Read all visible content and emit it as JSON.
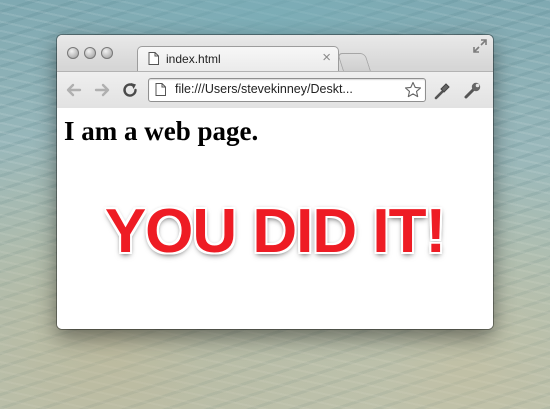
{
  "window": {
    "controls": [
      "close-button",
      "minimize-button",
      "zoom-button"
    ]
  },
  "tab": {
    "title": "index.html",
    "close_label": "×"
  },
  "toolbar": {
    "back_icon": "back-arrow-icon",
    "forward_icon": "forward-arrow-icon",
    "reload_icon": "reload-icon",
    "url": "file:///Users/stevekinney/Deskt...",
    "bookmark_icon": "star-icon",
    "page_menu_icon": "page-tool-icon",
    "settings_icon": "wrench-icon"
  },
  "page": {
    "heading": "I am a web page.",
    "banner": "YOU DID IT!"
  },
  "colors": {
    "banner_red": "#ee1c24",
    "chrome_gray": "#d6d6d6"
  }
}
